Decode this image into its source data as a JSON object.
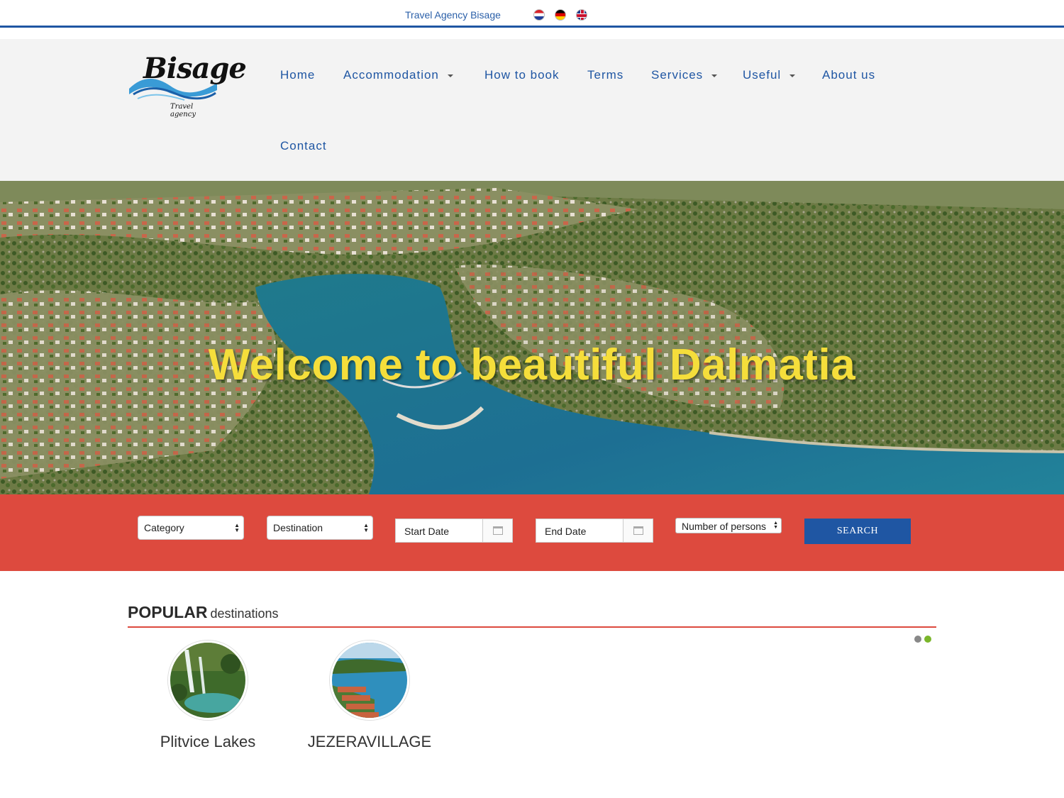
{
  "topbar": {
    "agency_link": "Travel Agency Bisage",
    "languages": [
      "Croatian",
      "German",
      "English"
    ]
  },
  "logo": {
    "name": "Bisage",
    "tagline": "Travel agency"
  },
  "nav": {
    "items": [
      {
        "label": "Home",
        "dropdown": false
      },
      {
        "label": "Accommodation",
        "dropdown": true
      },
      {
        "label": "How to book",
        "dropdown": false
      },
      {
        "label": "Terms",
        "dropdown": false
      },
      {
        "label": "Services",
        "dropdown": true
      },
      {
        "label": "Useful",
        "dropdown": true
      },
      {
        "label": "About us",
        "dropdown": false
      },
      {
        "label": "Contact",
        "dropdown": false
      }
    ]
  },
  "hero": {
    "title": "Welcome to beautiful Dalmatia"
  },
  "search": {
    "category": "Category",
    "destination": "Destination",
    "start_date": "Start Date",
    "end_date": "End Date",
    "persons": "Number of persons",
    "button": "SEARCH"
  },
  "popular": {
    "title_bold": "POPULAR",
    "title_light": "destinations",
    "destinations": [
      {
        "name": "Plitvice Lakes"
      },
      {
        "name": "JEZERAVILLAGE"
      }
    ],
    "carousel_active_dot": 2
  },
  "colors": {
    "brand_blue": "#1f56a3",
    "search_red": "#dd4a3e",
    "hero_title": "#f5de3b",
    "active_dot": "#7ab62b"
  }
}
